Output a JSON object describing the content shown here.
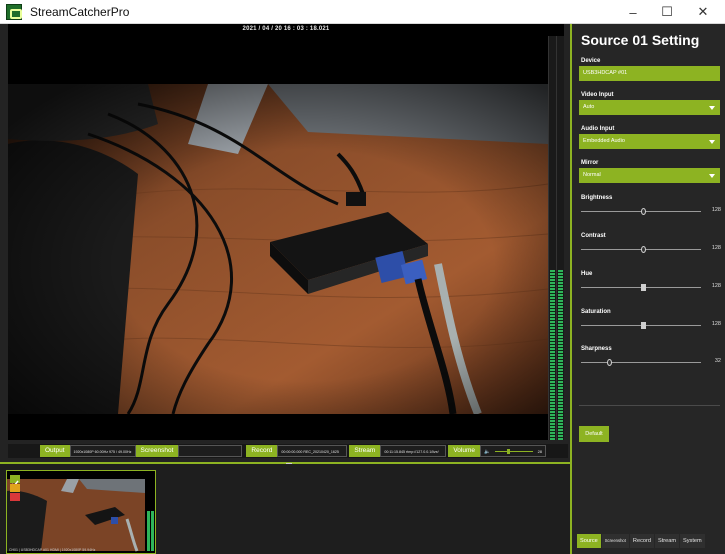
{
  "window": {
    "title": "StreamCatcherPro",
    "minimize_glyph": "–",
    "maximize_glyph": "☐",
    "close_glyph": "✕"
  },
  "preview": {
    "timestamp": "2021 / 04 / 20   16 : 03 : 18.021"
  },
  "status_strip": {
    "output_label": "Output",
    "output_value": "1920x1080P 60.00Hz    975 / 49.00Hz",
    "screenshot_label": "Screenshot",
    "record_label": "Record",
    "record_value": "00:00:00.000      REC_20210420_1625",
    "stream_label": "Stream",
    "stream_value": "00:11:15.845    rtmp://127.0.0.1/live/",
    "volume_label": "Volume",
    "volume_value": "28"
  },
  "thumbnail": {
    "caption": "CH01 | USB3HDCAP #01  HDMI  |  1920x1080P 59.94Hz"
  },
  "panel": {
    "title": "Source 01 Setting",
    "device_label": "Device",
    "device_value": "USB3HDCAP #01",
    "video_input_label": "Video Input",
    "video_input_value": "Auto",
    "audio_input_label": "Audio Input",
    "audio_input_value": "Embedded Audio",
    "mirror_label": "Mirror",
    "mirror_value": "Normal",
    "brightness_label": "Brightness",
    "brightness_value": "128",
    "contrast_label": "Contrast",
    "contrast_value": "128",
    "hue_label": "Hue",
    "hue_value": "128",
    "saturation_label": "Saturation",
    "saturation_value": "128",
    "sharpness_label": "Sharpness",
    "sharpness_value": "32",
    "default_button": "Default"
  },
  "tabs": [
    "Source",
    "Screenshot",
    "Record",
    "Stream",
    "System"
  ],
  "colors": {
    "accent": "#8db322",
    "background": "#232323",
    "vu_green": "#2fb55a"
  },
  "levels": {
    "vu_meter_fraction": 0.42
  }
}
